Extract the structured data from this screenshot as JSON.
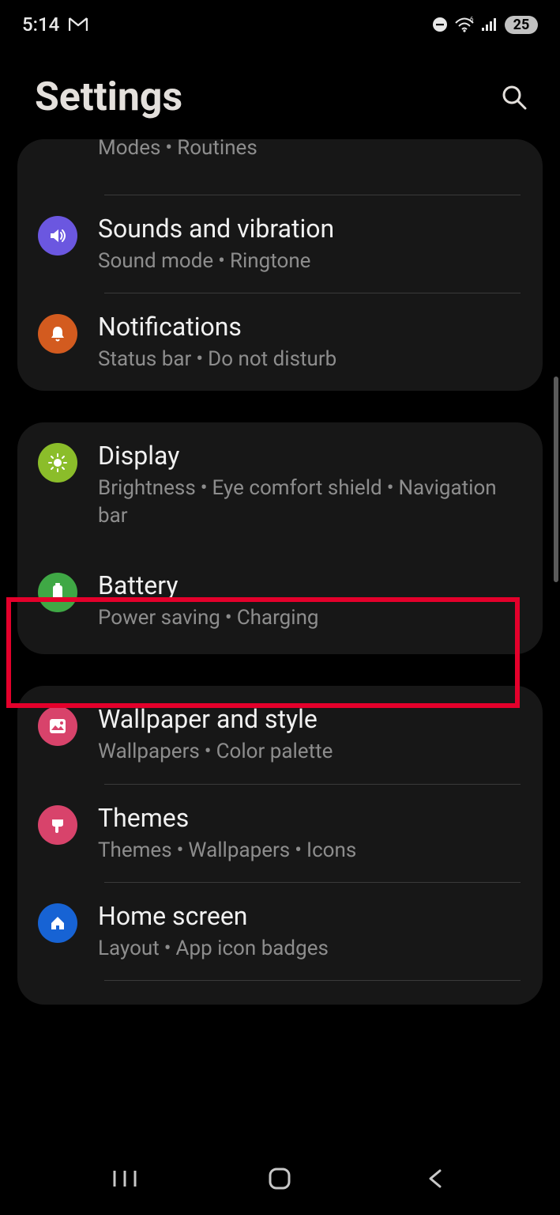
{
  "status": {
    "time": "5:14",
    "battery_pct": "25"
  },
  "header": {
    "title": "Settings"
  },
  "partial_top": {
    "subtitle_a": "Modes",
    "subtitle_b": "Routines"
  },
  "items": {
    "sounds": {
      "title": "Sounds and vibration",
      "sub_a": "Sound mode",
      "sub_b": "Ringtone"
    },
    "notifications": {
      "title": "Notifications",
      "sub_a": "Status bar",
      "sub_b": "Do not disturb"
    },
    "display": {
      "title": "Display",
      "sub_a": "Brightness",
      "sub_b": "Eye comfort shield",
      "sub_c": "Navigation bar"
    },
    "battery": {
      "title": "Battery",
      "sub_a": "Power saving",
      "sub_b": "Charging"
    },
    "wallpaper": {
      "title": "Wallpaper and style",
      "sub_a": "Wallpapers",
      "sub_b": "Color palette"
    },
    "themes": {
      "title": "Themes",
      "sub_a": "Themes",
      "sub_b": "Wallpapers",
      "sub_c": "Icons"
    },
    "home": {
      "title": "Home screen",
      "sub_a": "Layout",
      "sub_b": "App icon badges"
    }
  }
}
